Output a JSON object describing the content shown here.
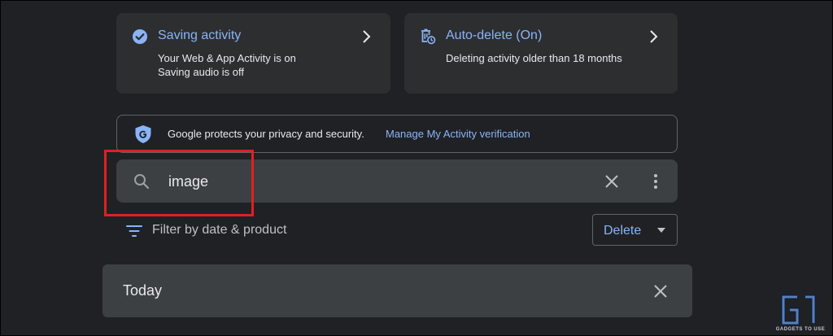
{
  "cards": {
    "saving": {
      "title": "Saving activity",
      "line1": "Your Web & App Activity is on",
      "line2": "Saving audio is off",
      "icon": "check-circle-icon"
    },
    "auto_delete": {
      "title": "Auto-delete (On)",
      "line1": "Deleting activity older than 18 months",
      "icon": "auto-delete-icon"
    }
  },
  "privacy": {
    "text": "Google protects your privacy and security.",
    "link": "Manage My Activity verification",
    "icon": "google-shield-icon"
  },
  "search": {
    "value": "image",
    "icons": [
      "search-icon",
      "close-icon",
      "more-vert-icon"
    ]
  },
  "filter": {
    "label": "Filter by date & product",
    "icon": "filter-icon"
  },
  "delete_button": {
    "label": "Delete"
  },
  "today": {
    "label": "Today"
  },
  "watermark": {
    "text": "GADGETS TO USE"
  },
  "colors": {
    "background": "#202124",
    "card": "#2d2e30",
    "field": "#3c4043",
    "accent": "#8ab4f8",
    "highlight": "#e02020"
  }
}
